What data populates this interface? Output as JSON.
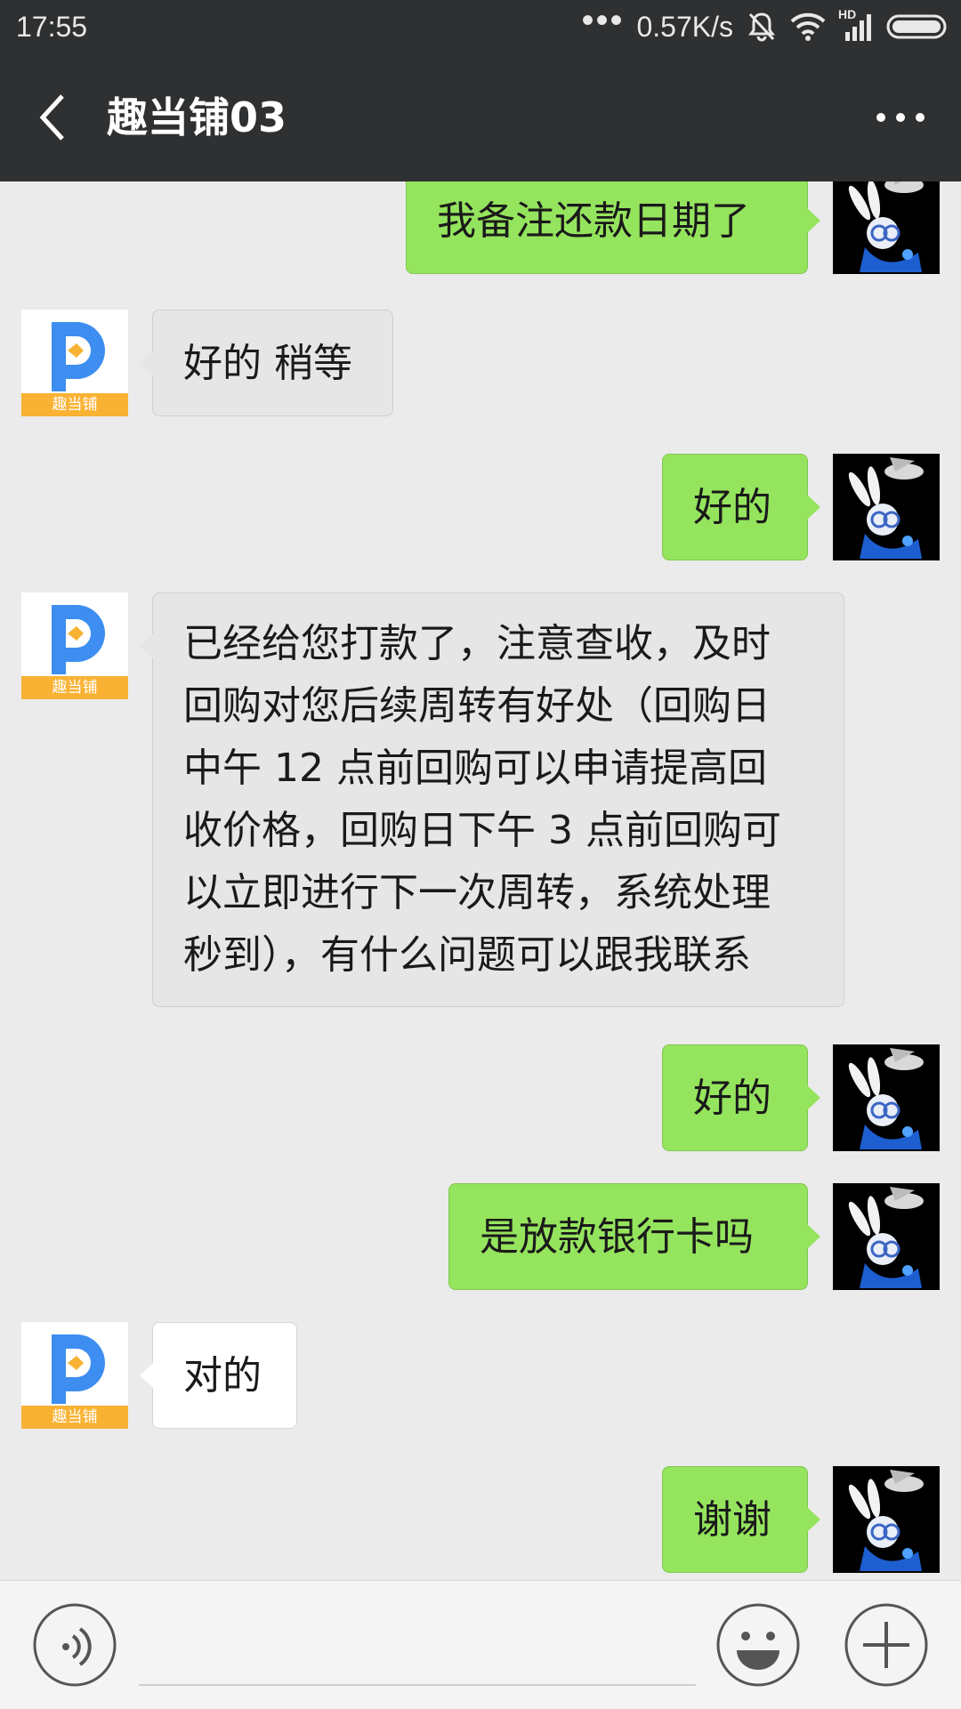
{
  "status_bar": {
    "time": "17:55",
    "network_speed": "0.57K/s",
    "hd_label": "HD"
  },
  "header": {
    "title": "趣当铺03"
  },
  "brand_colors": {
    "bubble_sent": "#95e45e",
    "header_bg": "#2f3031",
    "logo_blue": "#3d8ef0",
    "logo_orange": "#f9b233"
  },
  "contact": {
    "avatar_caption": "趣当铺"
  },
  "messages": [
    {
      "from": "me",
      "text": "我备注还款日期了"
    },
    {
      "from": "them",
      "text": "好的 稍等"
    },
    {
      "from": "me",
      "text": "好的"
    },
    {
      "from": "them",
      "lines": [
        "已经给您打款了，注意查收，及时",
        "回购对您后续周转有好处（回购日",
        "中午 12 点前回购可以申请提高回",
        "收价格，回购日下午 3 点前回购可",
        "以立即进行下一次周转，系统处理",
        "秒到），有什么问题可以跟我联系"
      ]
    },
    {
      "from": "me",
      "text": "好的"
    },
    {
      "from": "me",
      "text": "是放款银行卡吗"
    },
    {
      "from": "them",
      "text": "对的"
    },
    {
      "from": "me",
      "text": "谢谢"
    }
  ],
  "input_bar": {
    "icons": [
      "voice-icon",
      "emoji-icon",
      "plus-icon"
    ]
  }
}
